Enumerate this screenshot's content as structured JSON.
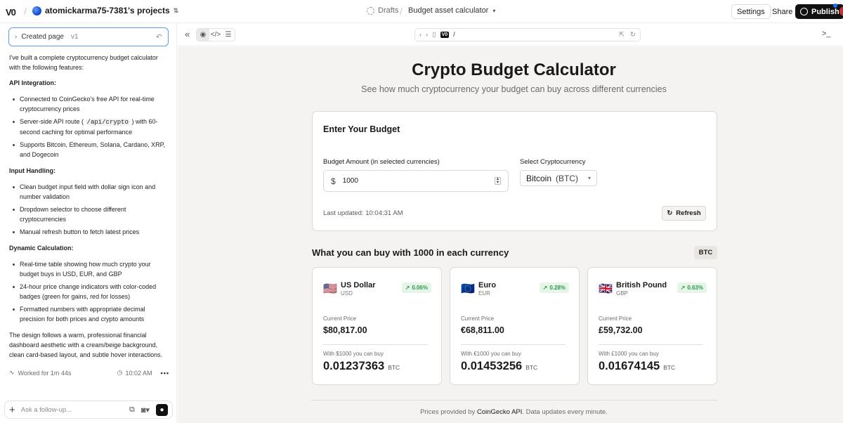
{
  "topbar": {
    "project": "atomickarma75-7381's projects",
    "drafts": "Drafts",
    "page_name": "Budget asset calculator",
    "settings": "Settings",
    "share": "Share",
    "publish": "Publish"
  },
  "chat": {
    "created_page": "Created page",
    "version": "v1",
    "intro": "I've built a complete cryptocurrency budget calculator with the following features:",
    "sections": [
      {
        "title": "API Integration:",
        "items": [
          "Connected to CoinGecko's free API for real-time cryptocurrency prices",
          "Server-side API route ( /api/crypto ) with 60-second caching for optimal performance",
          "Supports Bitcoin, Ethereum, Solana, Cardano, XRP, and Dogecoin"
        ]
      },
      {
        "title": "Input Handling:",
        "items": [
          "Clean budget input field with dollar sign icon and number validation",
          "Dropdown selector to choose different cryptocurrencies",
          "Manual refresh button to fetch latest prices"
        ]
      },
      {
        "title": "Dynamic Calculation:",
        "items": [
          "Real-time table showing how much crypto your budget buys in USD, EUR, and GBP",
          "24-hour price change indicators with color-coded badges (green for gains, red for losses)",
          "Formatted numbers with appropriate decimal precision for both prices and crypto amounts"
        ]
      }
    ],
    "outro": "The design follows a warm, professional financial dashboard aesthetic with a cream/beige background, clean card-based layout, and subtle hover interactions.",
    "worked_for": "Worked for 1m 44s",
    "time": "10:02 AM",
    "followup_placeholder": "Ask a follow-up..."
  },
  "preview_bar": {
    "url": "/"
  },
  "app": {
    "title": "Crypto Budget Calculator",
    "subtitle": "See how much cryptocurrency your budget can buy across different currencies",
    "budget_card": {
      "title": "Enter Your Budget",
      "amount_label": "Budget Amount (in selected currencies)",
      "amount_symbol": "$",
      "amount_value": "1000",
      "crypto_label": "Select Cryptocurrency",
      "crypto_selected": "Bitcoin",
      "crypto_symbol": "(BTC)",
      "last_updated": "Last updated: 10:04:31 AM",
      "refresh": "Refresh"
    },
    "results_heading": "What you can buy with 1000 in each currency",
    "results_badge": "BTC",
    "currencies": [
      {
        "flag": "🇺🇸",
        "name": "US Dollar",
        "code": "USD",
        "change": "0.06%",
        "price_label": "Current Price",
        "price": "$80,817.00",
        "with_label": "With $1000 you can buy",
        "amount": "0.01237363",
        "unit": "BTC"
      },
      {
        "flag": "🇪🇺",
        "name": "Euro",
        "code": "EUR",
        "change": "0.28%",
        "price_label": "Current Price",
        "price": "€68,811.00",
        "with_label": "With €1000 you can buy",
        "amount": "0.01453256",
        "unit": "BTC"
      },
      {
        "flag": "🇬🇧",
        "name": "British Pound",
        "code": "GBP",
        "change": "0.63%",
        "price_label": "Current Price",
        "price": "£59,732.00",
        "with_label": "With £1000 you can buy",
        "amount": "0.01674145",
        "unit": "BTC"
      }
    ],
    "footer_prefix": "Prices provided by",
    "footer_link": "CoinGecko API",
    "footer_suffix": ". Data updates every minute."
  }
}
